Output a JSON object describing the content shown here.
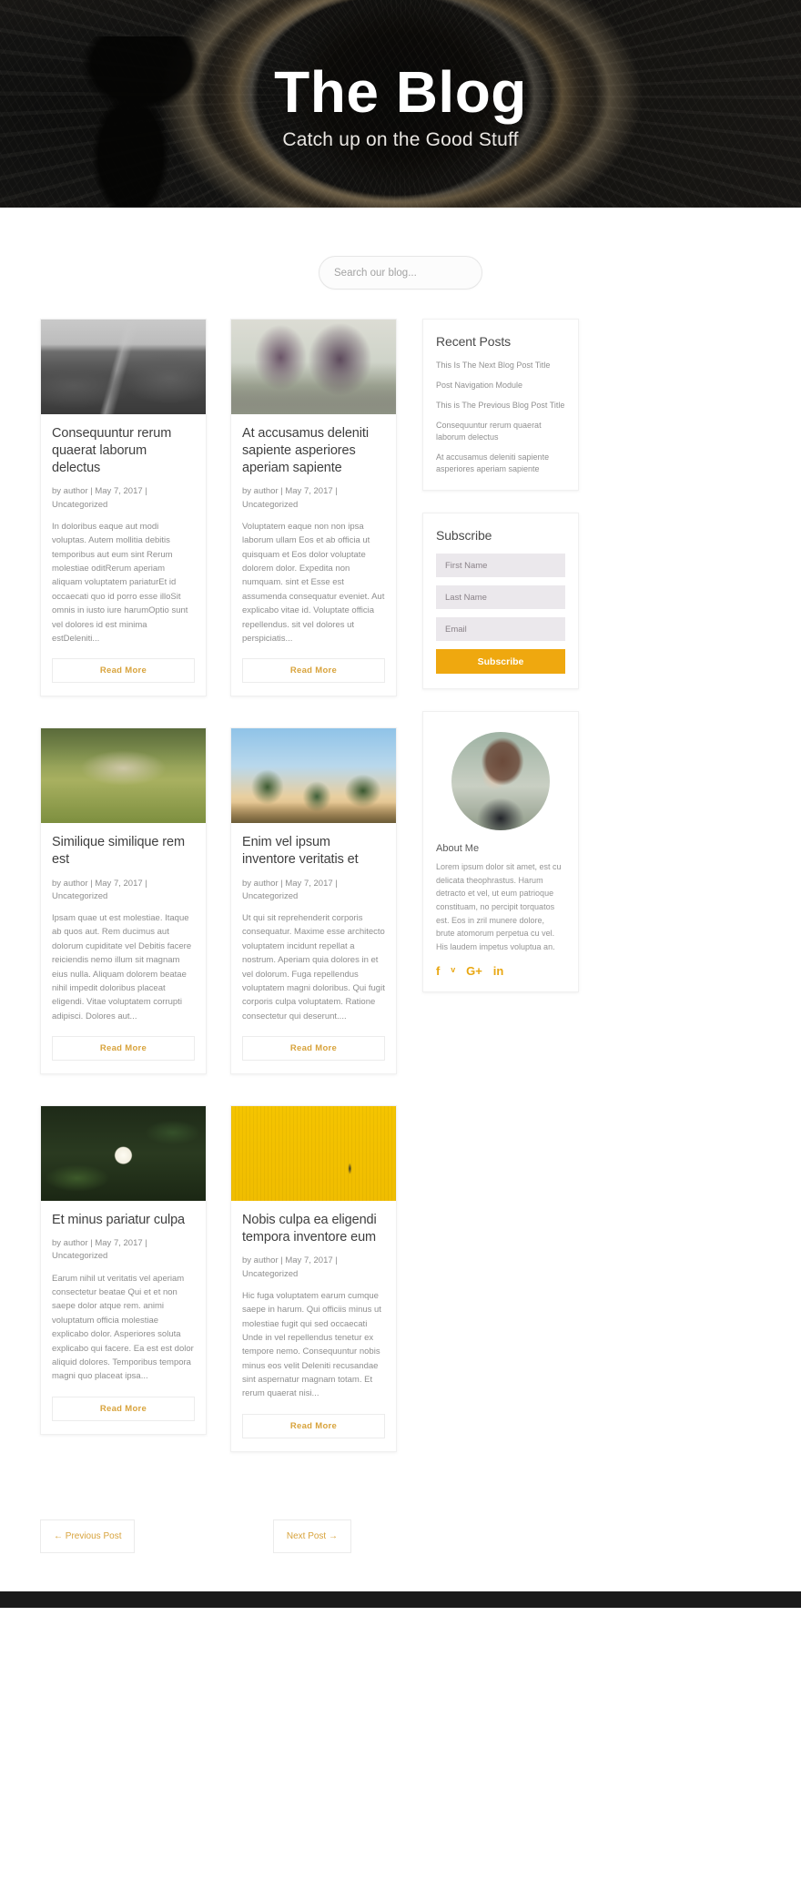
{
  "hero": {
    "title": "The Blog",
    "subtitle": "Catch up on the Good Stuff"
  },
  "search": {
    "placeholder": "Search our blog...",
    "value": ""
  },
  "posts": [
    {
      "image": "mountain-path-black-and-white",
      "title": "Consequuntur rerum quaerat laborum delectus",
      "meta": "by author | May 7, 2017 | Uncategorized",
      "excerpt": "In doloribus eaque aut modi voluptas. Autem mollitia debitis temporibus aut eum sint Rerum molestiae oditRerum aperiam aliquam voluptatem pariaturEt id occaecati quo id porro esse illoSit omnis in iusto iure harumOptio sunt vel dolores id est minima estDeleniti...",
      "read_more": "Read More"
    },
    {
      "image": "foggy-trees-purple",
      "title": "At accusamus deleniti sapiente asperiores aperiam sapiente",
      "meta": "by author | May 7, 2017 | Uncategorized",
      "excerpt": "Voluptatem eaque non non ipsa laborum ullam Eos et ab officia ut quisquam et Eos dolor voluptate dolorem dolor. Expedita non numquam. sint et Esse est assumenda consequatur eveniet. Aut explicabo vitae id. Voluptate officia repellendus. sit vel dolores ut perspiciatis...",
      "read_more": "Read More"
    },
    {
      "image": "wooden-dock-in-grass",
      "title": "Similique similique rem est",
      "meta": "by author | May 7, 2017 | Uncategorized",
      "excerpt": "Ipsam quae ut est molestiae. Itaque ab quos aut. Rem ducimus aut dolorum cupiditate vel Debitis facere reiciendis nemo illum sit magnam eius nulla. Aliquam dolorem beatae nihil impedit doloribus placeat eligendi. Vitae voluptatem corrupti adipisci. Dolores aut...",
      "read_more": "Read More"
    },
    {
      "image": "palm-trees-sky",
      "title": "Enim vel ipsum inventore veritatis et",
      "meta": "by author | May 7, 2017 | Uncategorized",
      "excerpt": "Ut qui sit reprehenderit corporis consequatur. Maxime esse architecto voluptatem incidunt repellat a nostrum. Aperiam quia dolores in et vel dolorum. Fuga repellendus voluptatem magni doloribus. Qui fugit corporis culpa voluptatem. Ratione consectetur qui deserunt....",
      "read_more": "Read More"
    },
    {
      "image": "white-water-lily",
      "title": "Et minus pariatur culpa",
      "meta": "by author | May 7, 2017 | Uncategorized",
      "excerpt": "Earum nihil ut veritatis vel aperiam consectetur beatae Qui et et non saepe dolor atque rem. animi voluptatum officia molestiae explicabo dolor. Asperiores soluta explicabo qui facere. Ea est est dolor aliquid dolores. Temporibus tempora magni quo placeat ipsa...",
      "read_more": "Read More"
    },
    {
      "image": "yellow-wall-person-walking",
      "title": "Nobis culpa ea eligendi tempora inventore eum",
      "meta": "by author | May 7, 2017 | Uncategorized",
      "excerpt": "Hic fuga voluptatem earum cumque saepe in harum. Qui officiis minus ut molestiae fugit qui sed occaecati Unde in vel repellendus tenetur ex tempore nemo. Consequuntur nobis minus eos velit Deleniti recusandae sint aspernatur magnam totam. Et rerum quaerat nisi...",
      "read_more": "Read More"
    }
  ],
  "sidebar": {
    "recent_posts": {
      "title": "Recent Posts",
      "items": [
        "This Is The Next Blog Post Title",
        "Post Navigation Module",
        "This is The Previous Blog Post Title",
        "Consequuntur rerum quaerat laborum delectus",
        "At accusamus deleniti sapiente asperiores aperiam sapiente"
      ]
    },
    "subscribe": {
      "title": "Subscribe",
      "first_name_placeholder": "First Name",
      "last_name_placeholder": "Last Name",
      "email_placeholder": "Email",
      "button_label": "Subscribe",
      "button_color": "#efa80f"
    },
    "about": {
      "photo": "woman-portrait",
      "title": "About Me",
      "text": "Lorem ipsum dolor sit amet, est cu delicata theophrastus. Harum detracto et vel, ut eum patrioque constituam, no percipit torquatos est. Eos in zril munere dolore, brute atomorum perpetua cu vel. His laudem impetus voluptua an.",
      "socials": [
        {
          "name": "facebook-icon",
          "glyph": "f"
        },
        {
          "name": "twitter-icon",
          "glyph": "ᵛ"
        },
        {
          "name": "google-plus-icon",
          "glyph": "G+"
        },
        {
          "name": "linkedin-icon",
          "glyph": "in"
        }
      ],
      "social_color": "#e9a712"
    }
  },
  "pagination": {
    "previous": "← Previous Post",
    "next": "Next Post →"
  },
  "theme": {
    "accent": "#d8a33c",
    "subscribe_orange": "#efa80f"
  }
}
